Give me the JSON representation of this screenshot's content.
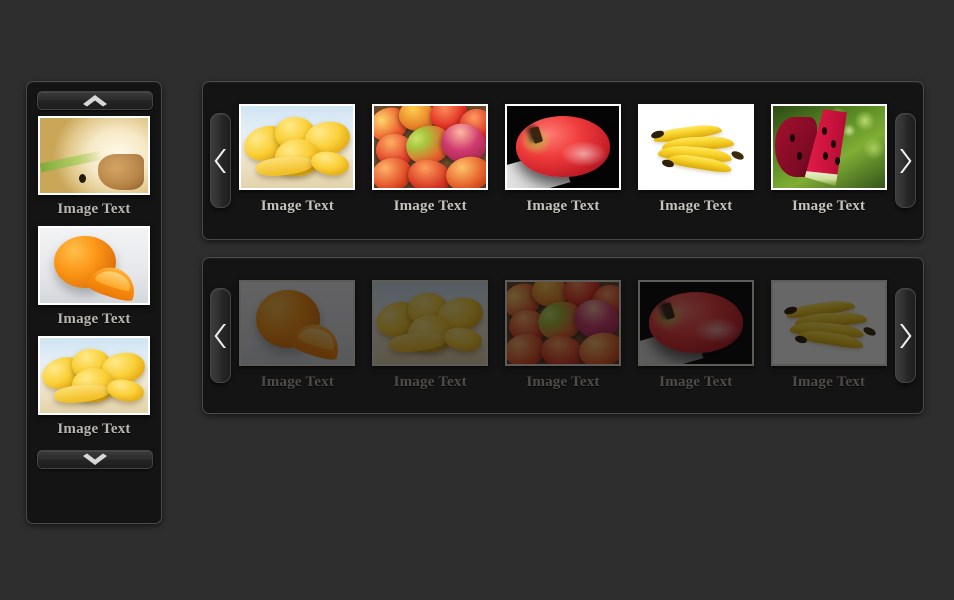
{
  "app": {
    "title": "Image Gallery Carousel",
    "background_color": "#2e2e2e",
    "panel_color": "#141414",
    "panel_border_color": "#4a4a4a",
    "caption_color": "#c6c3be",
    "caption_color_dimmed": "#4e4b48"
  },
  "sidebar": {
    "name": "vertical-thumbnail-carousel",
    "scroll_up": {
      "icon": "chevron-up-icon",
      "label": ""
    },
    "scroll_down": {
      "icon": "chevron-down-icon",
      "label": ""
    },
    "items": [
      {
        "caption": "Image Text",
        "art": "art-pear",
        "alt": "sliced pear and guava halves close-up"
      },
      {
        "caption": "Image Text",
        "art": "art-orange",
        "alt": "whole orange with wedge on white"
      },
      {
        "caption": "Image Text",
        "art": "art-mangoyellow",
        "alt": "pile of yellow mangoes and slices"
      }
    ]
  },
  "rows": [
    {
      "name": "featured-row",
      "state": "active",
      "prev": {
        "icon": "chevron-left-icon"
      },
      "next": {
        "icon": "chevron-right-icon"
      },
      "items": [
        {
          "caption": "Image Text",
          "art": "art-mangoyellow",
          "alt": "pile of yellow mangoes and slices"
        },
        {
          "caption": "Image Text",
          "art": "art-mangoes",
          "alt": "crate of red and green mangoes"
        },
        {
          "caption": "Image Text",
          "art": "art-apple",
          "alt": "red apple on black background"
        },
        {
          "caption": "Image Text",
          "art": "art-banana",
          "alt": "bunch of bananas on white"
        },
        {
          "caption": "Image Text",
          "art": "art-watermelon",
          "alt": "watermelon slice with green bokeh"
        }
      ]
    },
    {
      "name": "secondary-row",
      "state": "dimmed",
      "prev": {
        "icon": "chevron-left-icon"
      },
      "next": {
        "icon": "chevron-right-icon"
      },
      "items": [
        {
          "caption": "Image Text",
          "art": "art-orange",
          "alt": "whole orange with wedge"
        },
        {
          "caption": "Image Text",
          "art": "art-mangoyellow",
          "alt": "pile of yellow mangoes"
        },
        {
          "caption": "Image Text",
          "art": "art-mangoes",
          "alt": "crate of red and green mangoes"
        },
        {
          "caption": "Image Text",
          "art": "art-apple",
          "alt": "red apple"
        },
        {
          "caption": "Image Text",
          "art": "art-banana",
          "alt": "bunch of bananas"
        }
      ]
    }
  ]
}
